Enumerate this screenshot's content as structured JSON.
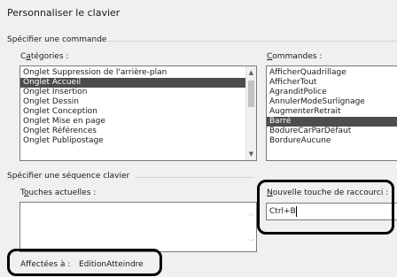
{
  "dialog": {
    "title": "Personnaliser le clavier"
  },
  "specify_command": {
    "section_label": "Spécifier une commande",
    "categories": {
      "label_first": "C",
      "label_ul": "a",
      "label_rest": "tégories :",
      "items": [
        "Onglet Suppression de l'arrière-plan",
        "Onglet Accueil",
        "Onglet Insertion",
        "Onglet Dessin",
        "Onglet Conception",
        "Onglet Mise en page",
        "Onglet Références",
        "Onglet Publipostage"
      ],
      "selected_index": 1
    },
    "commands": {
      "label_ul": "C",
      "label_rest": "ommandes :",
      "items": [
        "AfficherQuadrillage",
        "AfficherTout",
        "AgranditPolice",
        "AnnulerModeSurlignage",
        "AugmenterRetrait",
        "Barré",
        "BodureCarParDéfaut",
        "BordureAucune"
      ],
      "selected_index": 5
    }
  },
  "key_sequence": {
    "section_label": "Spécifier une séquence clavier",
    "current_keys": {
      "label_first": "T",
      "label_ul": "o",
      "label_rest": "uches actuelles :"
    },
    "new_shortcut": {
      "label_ul": "N",
      "label_rest": "ouvelle touche de raccourci :",
      "value": "Ctrl+B"
    },
    "assigned": {
      "label": "Affectées à :",
      "value": "EditionAtteindre"
    }
  }
}
